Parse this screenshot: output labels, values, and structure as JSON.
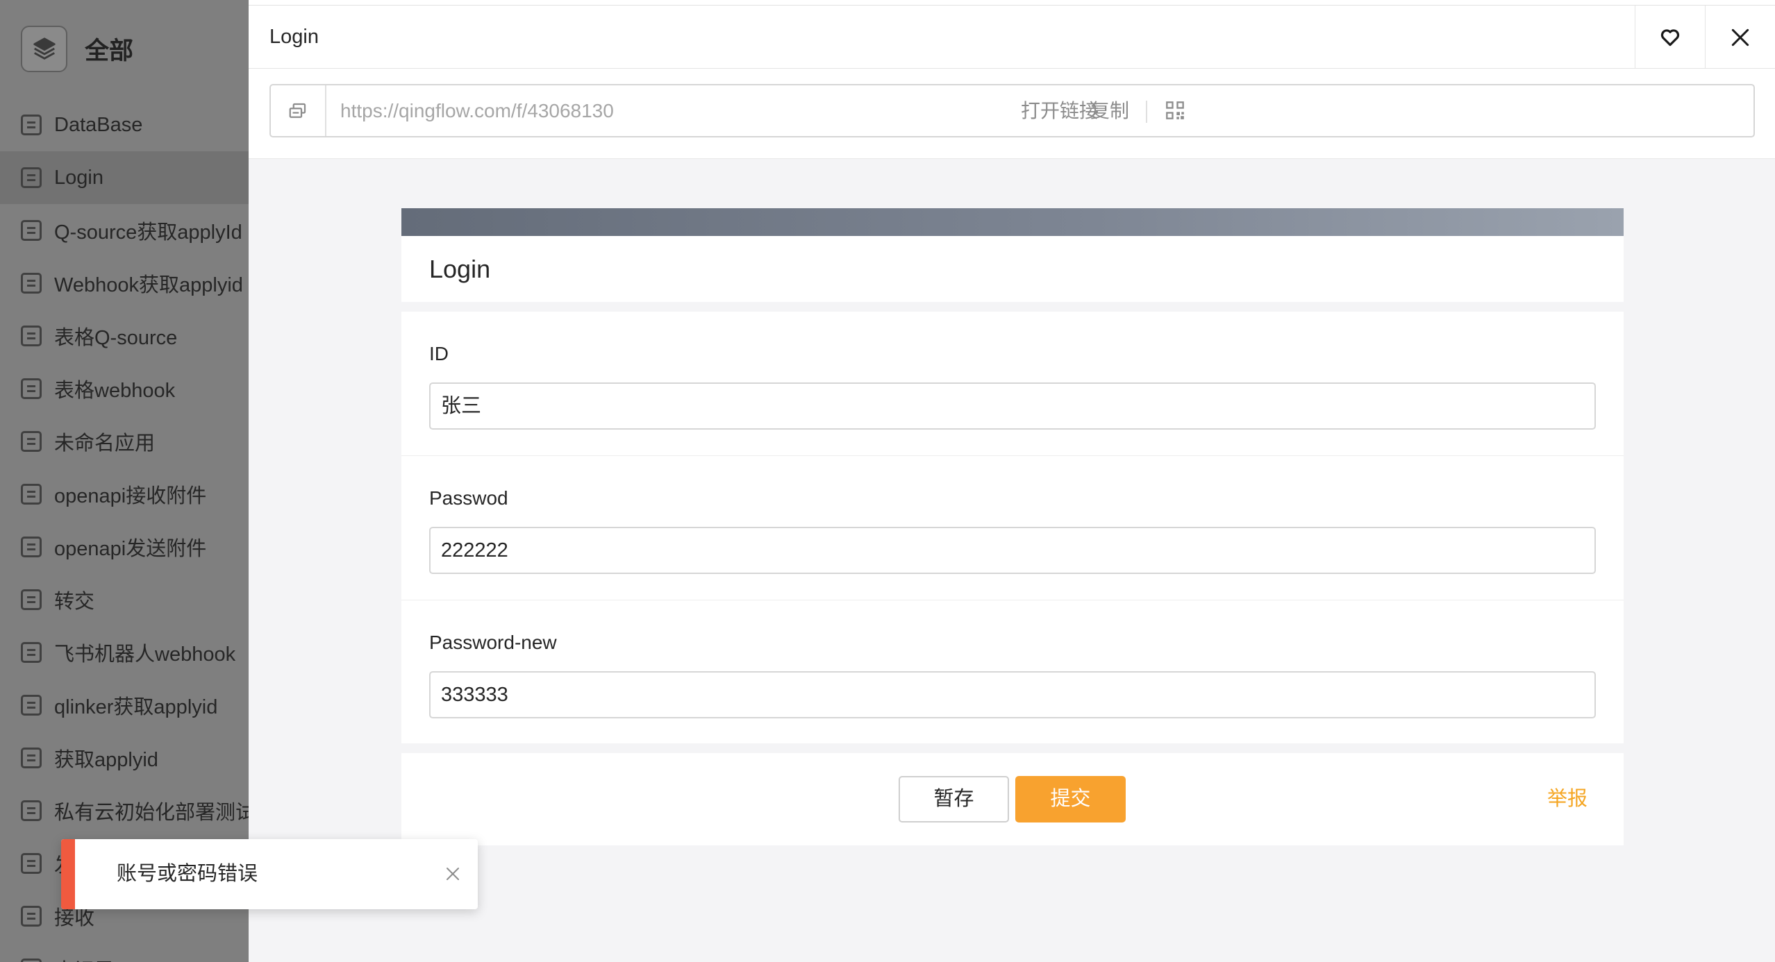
{
  "sidebar": {
    "title": "全部",
    "items": [
      {
        "label": "DataBase",
        "active": false
      },
      {
        "label": "Login",
        "active": true
      },
      {
        "label": "Q-source获取applyId",
        "active": false
      },
      {
        "label": "Webhook获取applyid",
        "active": false
      },
      {
        "label": "表格Q-source",
        "active": false
      },
      {
        "label": "表格webhook",
        "active": false
      },
      {
        "label": "未命名应用",
        "active": false
      },
      {
        "label": "openapi接收附件",
        "active": false
      },
      {
        "label": "openapi发送附件",
        "active": false
      },
      {
        "label": "转交",
        "active": false
      },
      {
        "label": "飞书机器人webhook",
        "active": false
      },
      {
        "label": "qlinker获取applyid",
        "active": false
      },
      {
        "label": "获取applyid",
        "active": false
      },
      {
        "label": "私有云初始化部署测试",
        "active": false
      },
      {
        "label": "发",
        "active": false
      },
      {
        "label": "接收",
        "active": false
      },
      {
        "label": "未记录",
        "active": false
      }
    ]
  },
  "header": {
    "title": "Login"
  },
  "urlbar": {
    "url": "https://qingflow.com/f/43068130",
    "open_label": "打开链接",
    "copy_label": "复制"
  },
  "form": {
    "title": "Login",
    "fields": [
      {
        "label": "ID",
        "value": "张三"
      },
      {
        "label": "Passwod",
        "value": "222222"
      },
      {
        "label": "Password-new",
        "value": "333333"
      }
    ],
    "save_label": "暂存",
    "submit_label": "提交",
    "report_label": "举报"
  },
  "toast": {
    "message": "账号或密码错误"
  },
  "colors": {
    "accent": "#f8a22f",
    "error": "#f05a3f",
    "report": "#f5a623"
  }
}
